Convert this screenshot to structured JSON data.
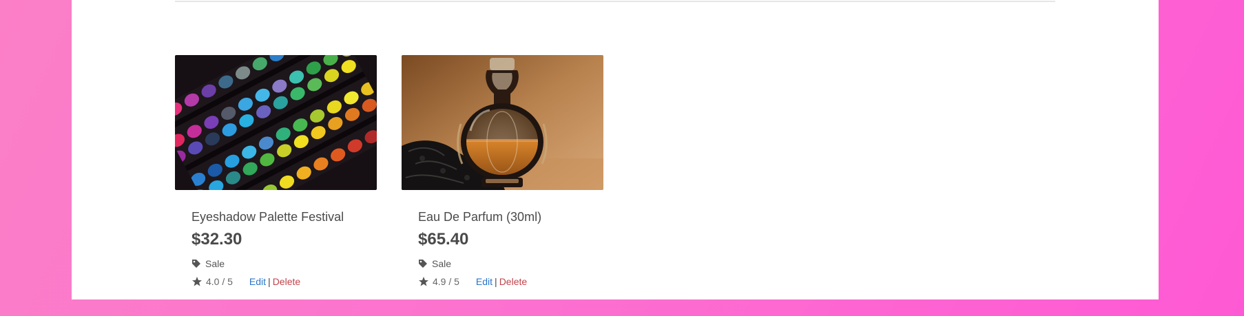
{
  "products": [
    {
      "title": "Eyeshadow Palette Festival",
      "price": "$32.30",
      "tag_icon": "tag-icon",
      "tag": "Sale",
      "rating_icon": "star-icon",
      "rating": "4.0 / 5",
      "edit_label": "Edit",
      "separator": "|",
      "delete_label": "Delete"
    },
    {
      "title": "Eau De Parfum (30ml)",
      "price": "$65.40",
      "tag_icon": "tag-icon",
      "tag": "Sale",
      "rating_icon": "star-icon",
      "rating": "4.9 / 5",
      "edit_label": "Edit",
      "separator": "|",
      "delete_label": "Delete"
    }
  ],
  "colors": {
    "background_start": "#fb7fc7",
    "background_end": "#fe59d4",
    "edit_link": "#2a74c9",
    "delete_link": "#c0434b",
    "text": "#4a4a4a"
  }
}
